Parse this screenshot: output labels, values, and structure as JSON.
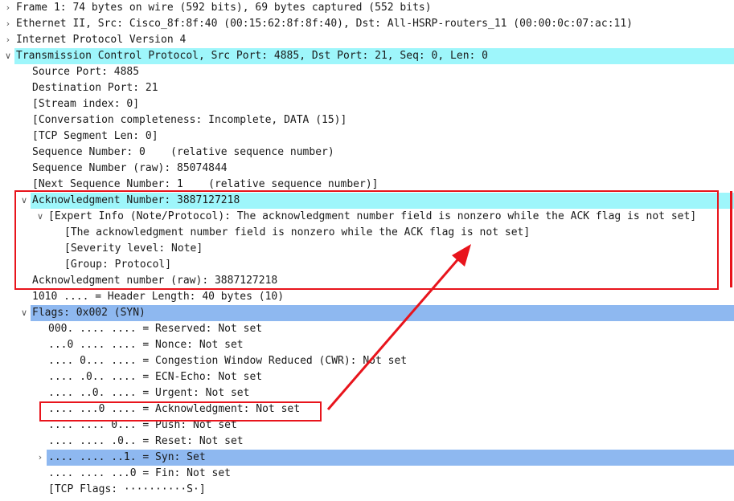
{
  "tree": {
    "rows": [
      {
        "arrow": "right",
        "text": "Frame 1: 74 bytes on wire (592 bits), 69 bytes captured (552 bits)"
      },
      {
        "arrow": "right",
        "text": "Ethernet II, Src: Cisco_8f:8f:40 (00:15:62:8f:8f:40), Dst: All-HSRP-routers_11 (00:00:0c:07:ac:11)"
      },
      {
        "arrow": "right",
        "text": "Internet Protocol Version 4"
      },
      {
        "arrow": "down",
        "text": "Transmission Control Protocol, Src Port: 4885, Dst Port: 21, Seq: 0, Len: 0"
      },
      {
        "text": "Source Port: 4885"
      },
      {
        "text": "Destination Port: 21"
      },
      {
        "text": "[Stream index: 0]"
      },
      {
        "text": "[Conversation completeness: Incomplete, DATA (15)]"
      },
      {
        "text": "[TCP Segment Len: 0]"
      },
      {
        "text": "Sequence Number: 0    (relative sequence number)"
      },
      {
        "text": "Sequence Number (raw): 85074844"
      },
      {
        "text": "[Next Sequence Number: 1    (relative sequence number)]"
      },
      {
        "arrow": "down",
        "text": "Acknowledgment Number: 3887127218"
      },
      {
        "arrow": "down",
        "text": "[Expert Info (Note/Protocol): The acknowledgment number field is nonzero while the ACK flag is not set]"
      },
      {
        "text": "[The acknowledgment number field is nonzero while the ACK flag is not set]"
      },
      {
        "text": "[Severity level: Note]"
      },
      {
        "text": "[Group: Protocol]"
      },
      {
        "text": "Acknowledgment number (raw): 3887127218"
      },
      {
        "text": "1010 .... = Header Length: 40 bytes (10)"
      },
      {
        "arrow": "down",
        "text": "Flags: 0x002 (SYN)"
      },
      {
        "text": "000. .... .... = Reserved: Not set"
      },
      {
        "text": "...0 .... .... = Nonce: Not set"
      },
      {
        "text": ".... 0... .... = Congestion Window Reduced (CWR): Not set"
      },
      {
        "text": ".... .0.. .... = ECN-Echo: Not set"
      },
      {
        "text": ".... ..0. .... = Urgent: Not set"
      },
      {
        "text": ".... ...0 .... = Acknowledgment: Not set"
      },
      {
        "text": ".... .... 0... = Push: Not set"
      },
      {
        "text": ".... .... .0.. = Reset: Not set"
      },
      {
        "arrow": "right",
        "text": ".... .... ..1. = Syn: Set"
      },
      {
        "text": ".... .... ...0 = Fin: Not set"
      },
      {
        "text": "[TCP Flags: ··········S·]"
      }
    ]
  },
  "colors": {
    "selection_cyan": "#9ef6fb",
    "selection_blue": "#8eb8f0",
    "annotation_red": "#e8141c"
  }
}
